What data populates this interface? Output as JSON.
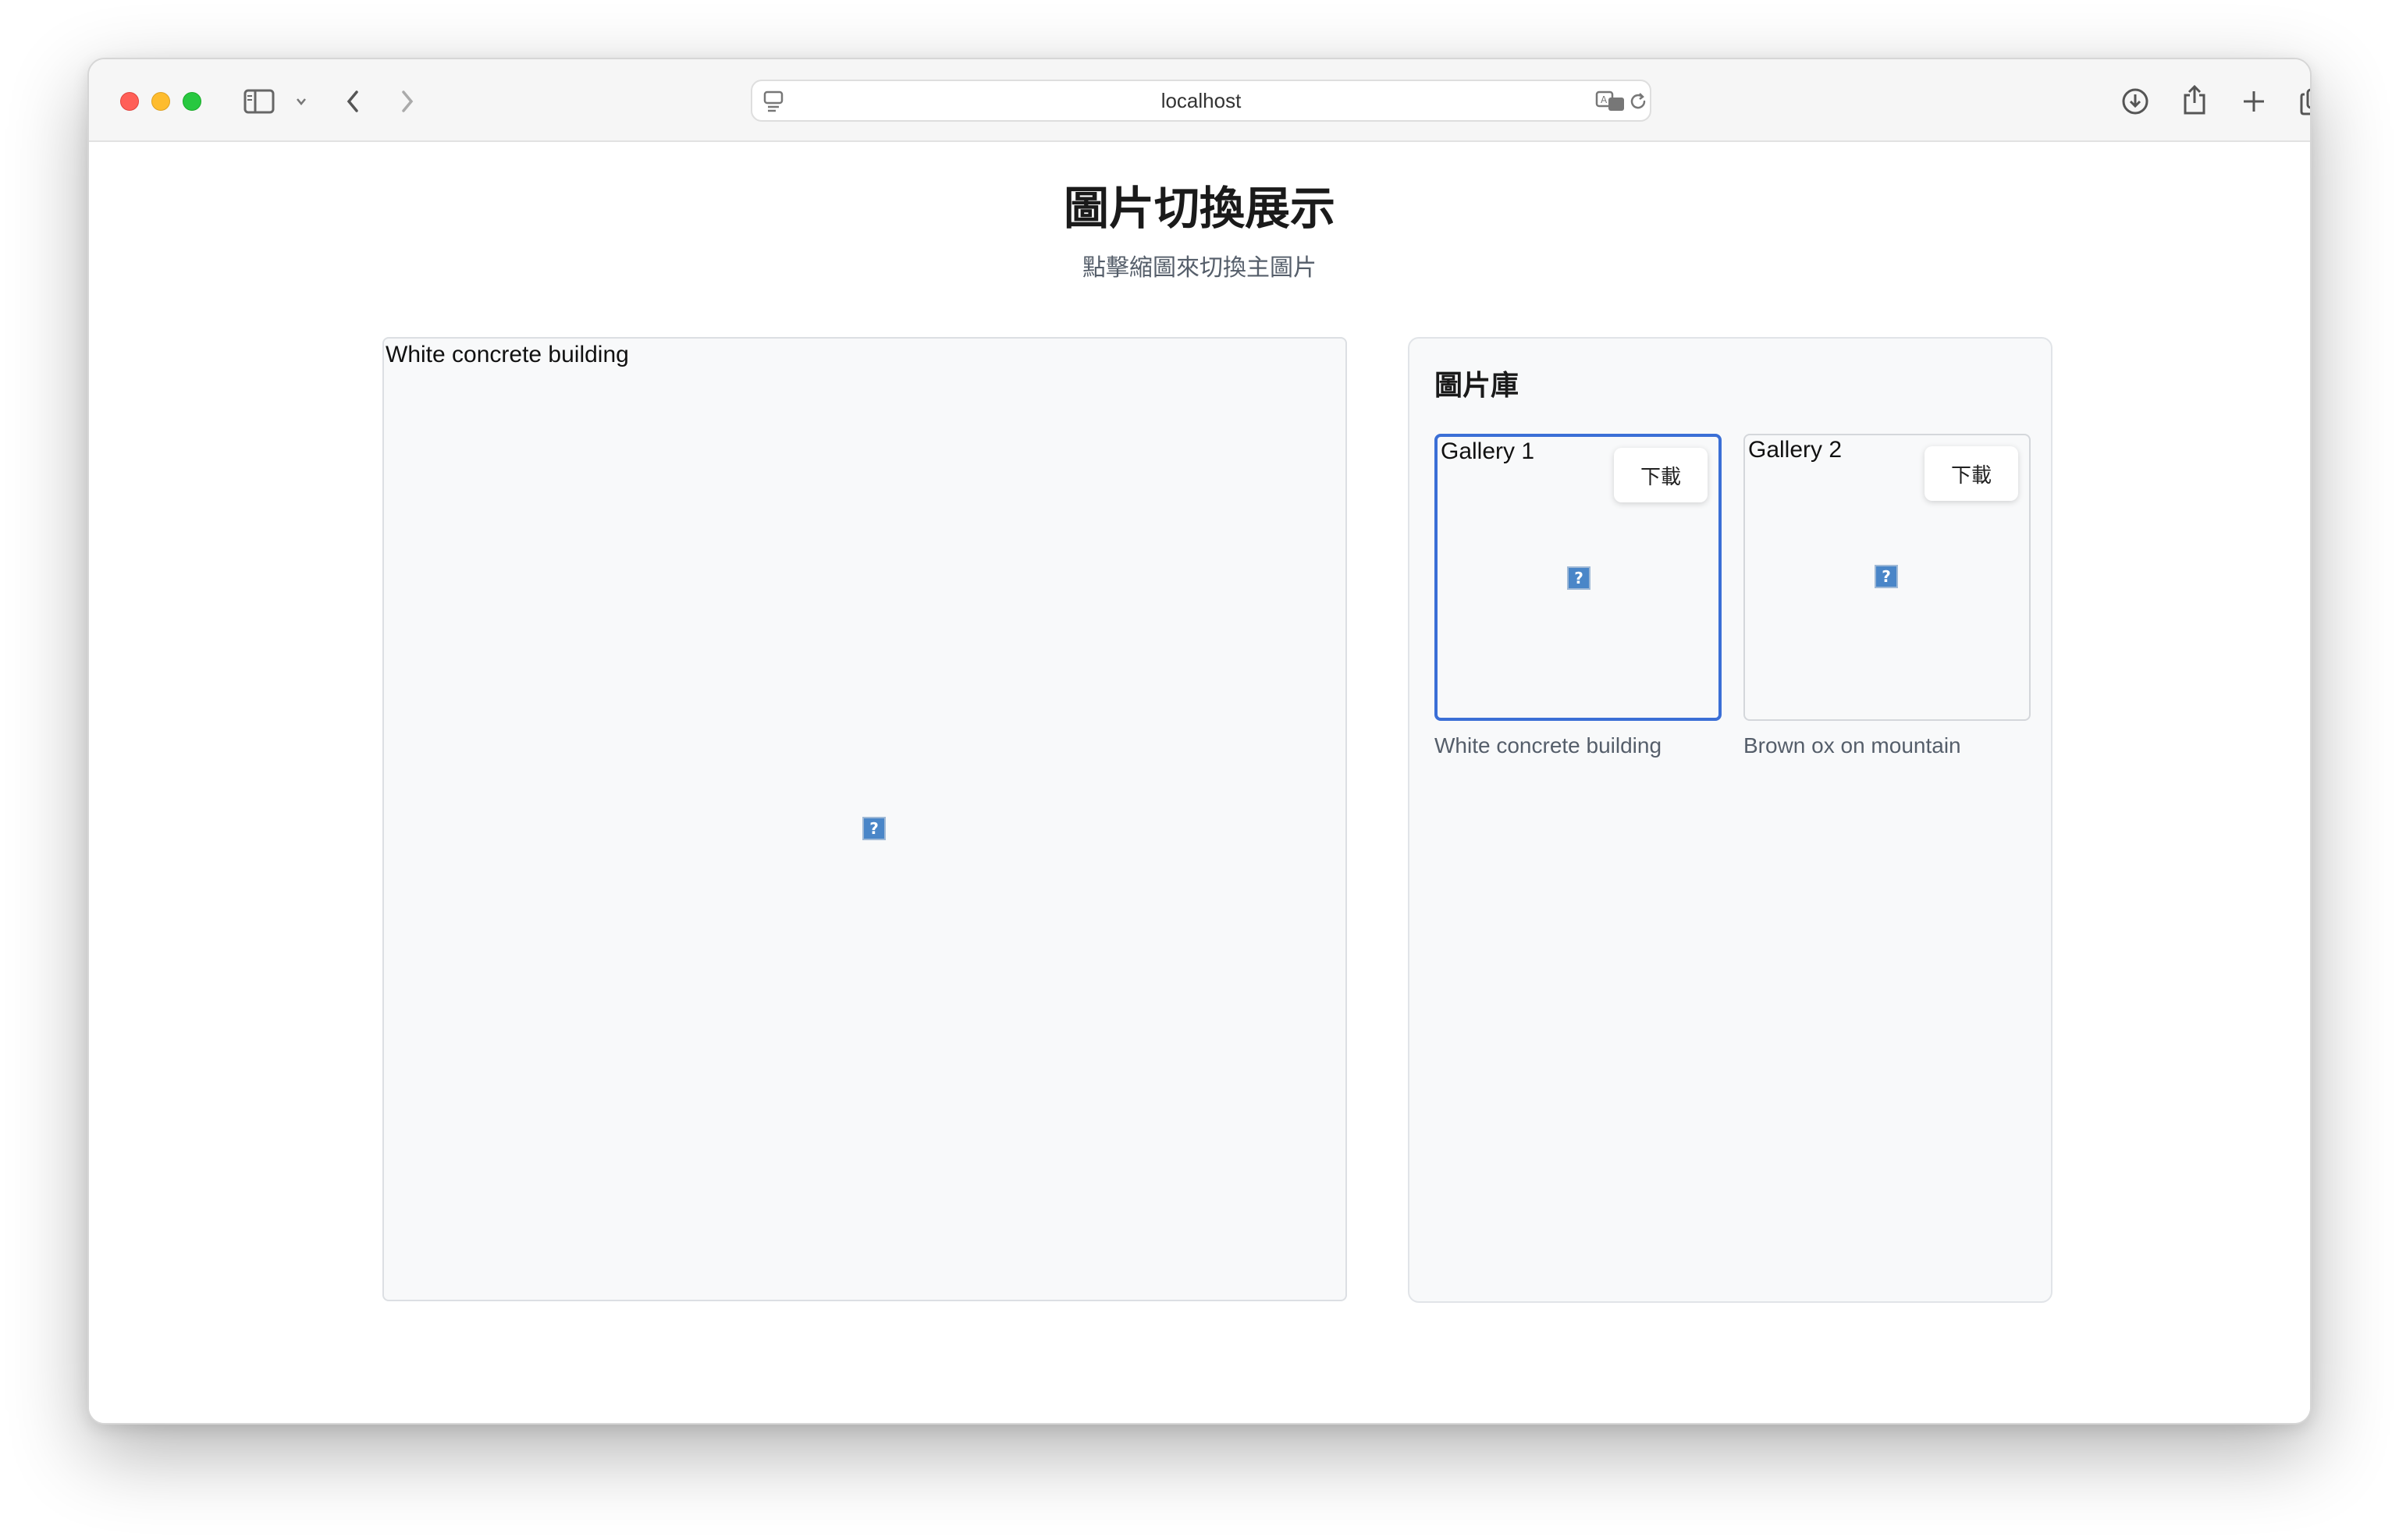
{
  "browser": {
    "url": "localhost",
    "icons": {
      "sidebar": "sidebar-icon",
      "back": "chevron-left-icon",
      "forward": "chevron-right-icon",
      "translate": "translate-icon",
      "reload": "reload-icon",
      "download": "download-icon",
      "share": "share-icon",
      "new_tab": "plus-icon",
      "tabs": "tabs-overview-icon"
    }
  },
  "page": {
    "title": "圖片切換展示",
    "subtitle": "點擊縮圖來切換主圖片"
  },
  "main_image": {
    "alt": "White concrete building",
    "broken_glyph": "?"
  },
  "gallery": {
    "title": "圖片庫",
    "items": [
      {
        "alt": "Gallery 1",
        "caption": "White concrete building",
        "download_label": "下載",
        "broken_glyph": "?",
        "active": true
      },
      {
        "alt": "Gallery 2",
        "caption": "Brown ox on mountain",
        "download_label": "下載",
        "broken_glyph": "?",
        "active": false
      }
    ]
  },
  "colors": {
    "accent": "#3b6fd6",
    "panel_bg": "#f8f9fa"
  }
}
